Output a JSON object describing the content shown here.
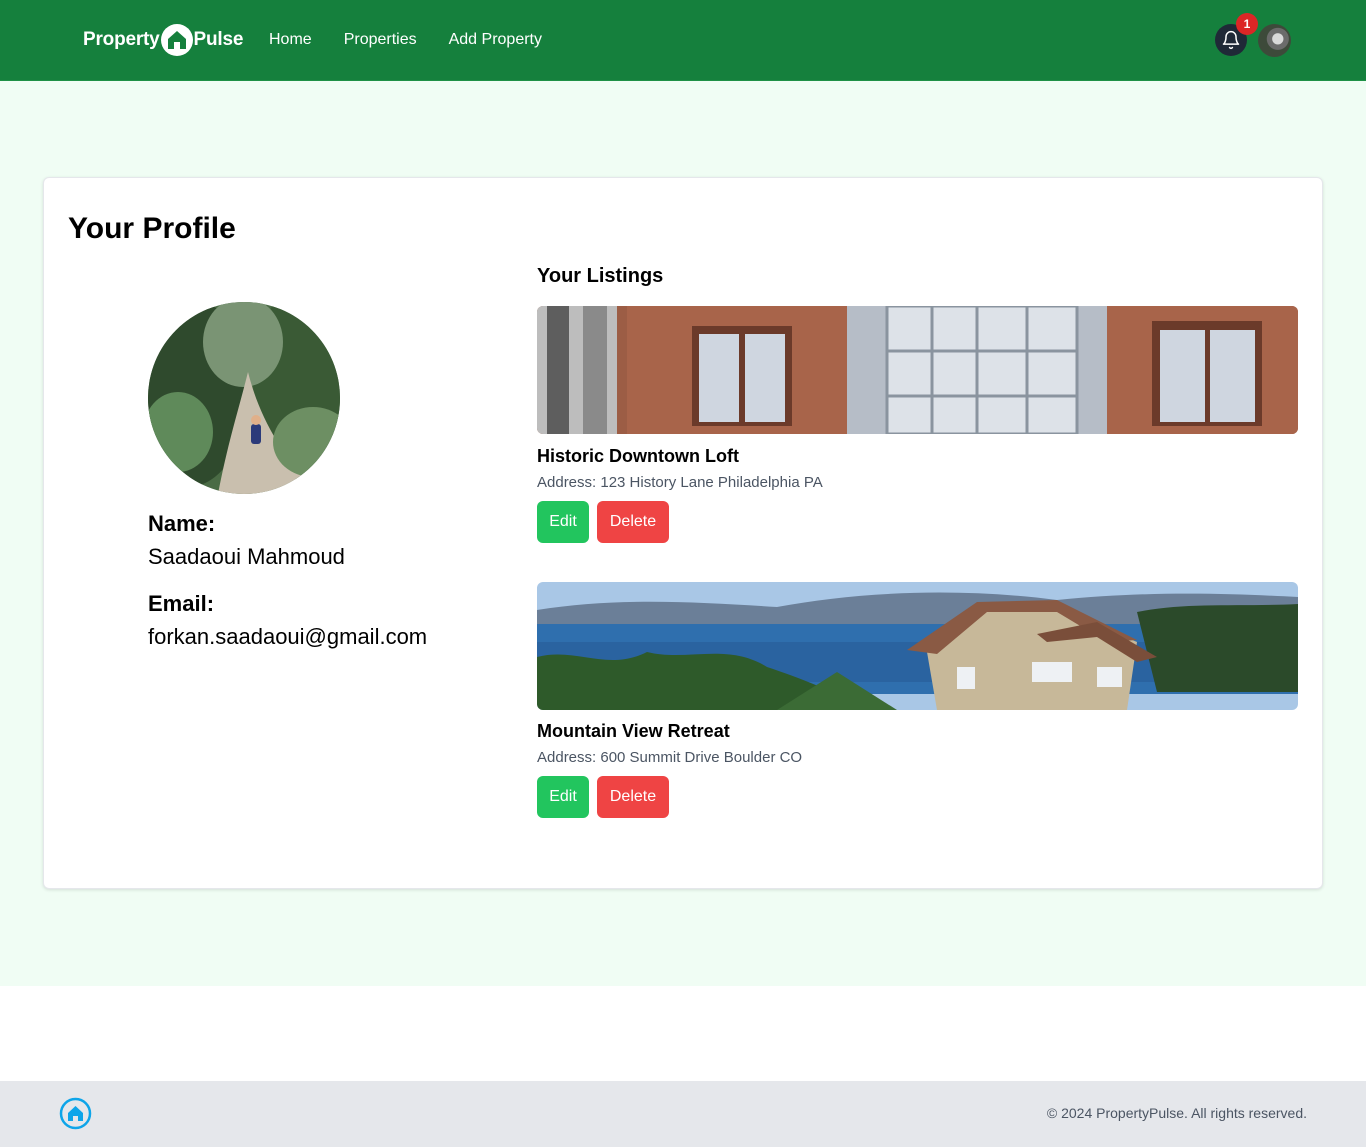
{
  "brand": {
    "part1": "Property",
    "part2": "Pulse"
  },
  "nav": {
    "links": [
      "Home",
      "Properties",
      "Add Property"
    ]
  },
  "notifications": {
    "count": "1"
  },
  "profile": {
    "title": "Your Profile",
    "name_label": "Name:",
    "name": "Saadaoui Mahmoud",
    "email_label": "Email:",
    "email": "forkan.saadaoui@gmail.com"
  },
  "listings": {
    "title": "Your Listings",
    "items": [
      {
        "name": "Historic Downtown Loft",
        "address": "Address: 123 History Lane Philadelphia PA",
        "edit_label": "Edit",
        "delete_label": "Delete"
      },
      {
        "name": "Mountain View Retreat",
        "address": "Address: 600 Summit Drive Boulder CO",
        "edit_label": "Edit",
        "delete_label": "Delete"
      }
    ]
  },
  "footer": {
    "copyright": "© 2024 PropertyPulse. All rights reserved."
  },
  "colors": {
    "nav_bg": "#15803d",
    "page_bg": "#f0fdf4",
    "edit": "#22c55e",
    "delete": "#ef4444",
    "badge": "#dc2626"
  },
  "icons": {
    "logo": "house-icon",
    "notifications": "bell-icon",
    "footer_logo": "house-icon"
  }
}
